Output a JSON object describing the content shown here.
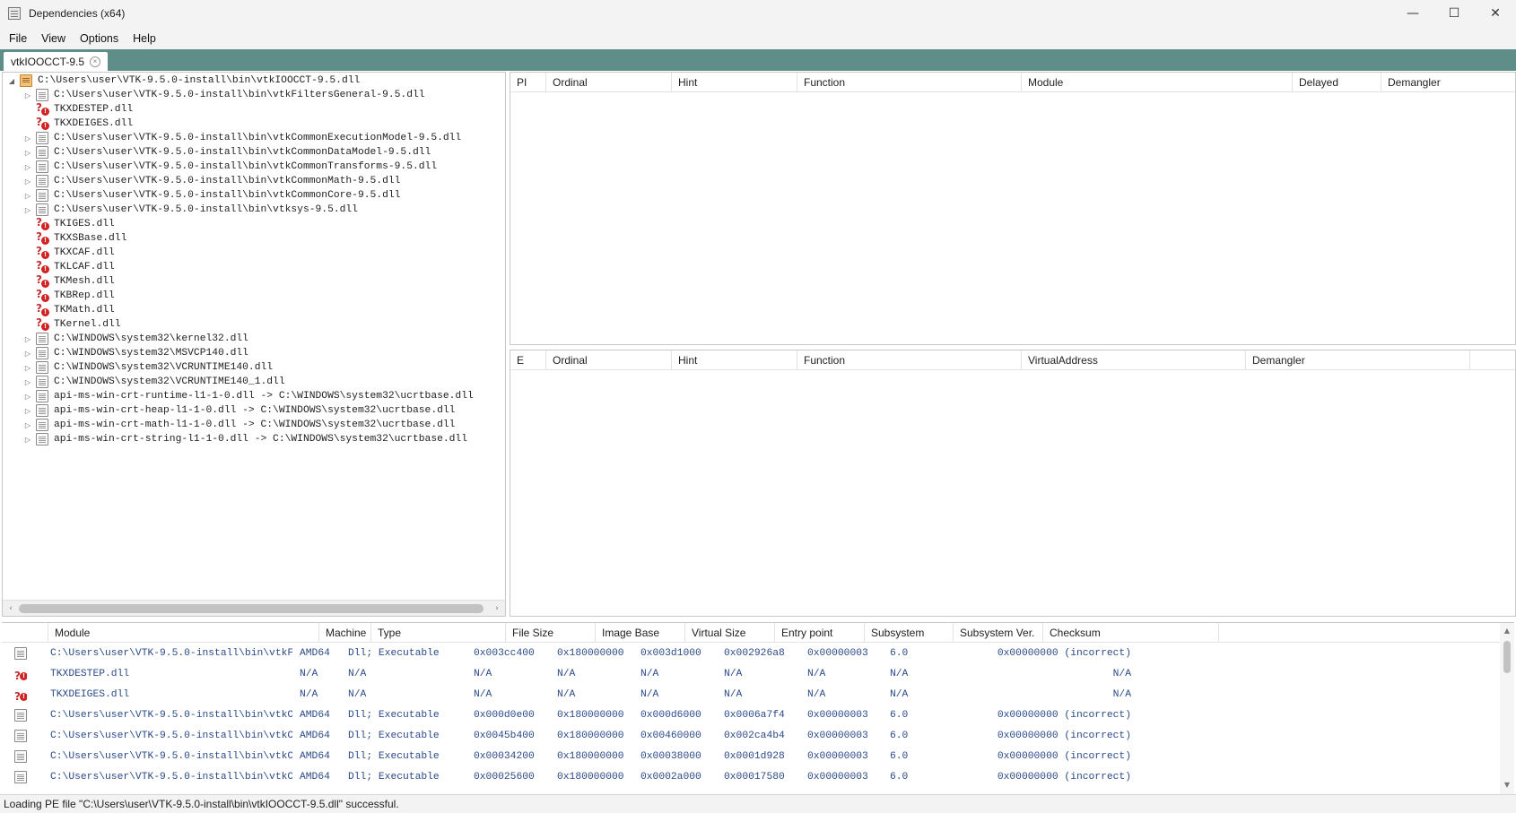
{
  "window": {
    "title": "Dependencies (x64)",
    "controls": [
      "—",
      "☐",
      "✕"
    ]
  },
  "menu": [
    "File",
    "View",
    "Options",
    "Help"
  ],
  "tab": {
    "label": "vtkIOOCCT-9.5",
    "close": "×"
  },
  "tree": [
    {
      "text": "C:\\Users\\user\\VTK-9.5.0-install\\bin\\vtkIOOCCT-9.5.dll",
      "icon": "root",
      "toggle": "◢",
      "indent": 0
    },
    {
      "text": "C:\\Users\\user\\VTK-9.5.0-install\\bin\\vtkFiltersGeneral-9.5.dll",
      "icon": "file",
      "toggle": "▷",
      "indent": 1
    },
    {
      "text": "TKXDESTEP.dll",
      "icon": "missing",
      "toggle": "",
      "indent": 1
    },
    {
      "text": "TKXDEIGES.dll",
      "icon": "missing",
      "toggle": "",
      "indent": 1
    },
    {
      "text": "C:\\Users\\user\\VTK-9.5.0-install\\bin\\vtkCommonExecutionModel-9.5.dll",
      "icon": "file",
      "toggle": "▷",
      "indent": 1
    },
    {
      "text": "C:\\Users\\user\\VTK-9.5.0-install\\bin\\vtkCommonDataModel-9.5.dll",
      "icon": "file",
      "toggle": "▷",
      "indent": 1
    },
    {
      "text": "C:\\Users\\user\\VTK-9.5.0-install\\bin\\vtkCommonTransforms-9.5.dll",
      "icon": "file",
      "toggle": "▷",
      "indent": 1
    },
    {
      "text": "C:\\Users\\user\\VTK-9.5.0-install\\bin\\vtkCommonMath-9.5.dll",
      "icon": "file",
      "toggle": "▷",
      "indent": 1
    },
    {
      "text": "C:\\Users\\user\\VTK-9.5.0-install\\bin\\vtkCommonCore-9.5.dll",
      "icon": "file",
      "toggle": "▷",
      "indent": 1
    },
    {
      "text": "C:\\Users\\user\\VTK-9.5.0-install\\bin\\vtksys-9.5.dll",
      "icon": "file",
      "toggle": "▷",
      "indent": 1
    },
    {
      "text": "TKIGES.dll",
      "icon": "missing",
      "toggle": "",
      "indent": 1
    },
    {
      "text": "TKXSBase.dll",
      "icon": "missing",
      "toggle": "",
      "indent": 1
    },
    {
      "text": "TKXCAF.dll",
      "icon": "missing",
      "toggle": "",
      "indent": 1
    },
    {
      "text": "TKLCAF.dll",
      "icon": "missing",
      "toggle": "",
      "indent": 1
    },
    {
      "text": "TKMesh.dll",
      "icon": "missing",
      "toggle": "",
      "indent": 1
    },
    {
      "text": "TKBRep.dll",
      "icon": "missing",
      "toggle": "",
      "indent": 1
    },
    {
      "text": "TKMath.dll",
      "icon": "missing",
      "toggle": "",
      "indent": 1
    },
    {
      "text": "TKernel.dll",
      "icon": "missing",
      "toggle": "",
      "indent": 1
    },
    {
      "text": "C:\\WINDOWS\\system32\\kernel32.dll",
      "icon": "file",
      "toggle": "▷",
      "indent": 1
    },
    {
      "text": "C:\\WINDOWS\\system32\\MSVCP140.dll",
      "icon": "file",
      "toggle": "▷",
      "indent": 1
    },
    {
      "text": "C:\\WINDOWS\\system32\\VCRUNTIME140.dll",
      "icon": "file",
      "toggle": "▷",
      "indent": 1
    },
    {
      "text": "C:\\WINDOWS\\system32\\VCRUNTIME140_1.dll",
      "icon": "file",
      "toggle": "▷",
      "indent": 1
    },
    {
      "text": "api-ms-win-crt-runtime-l1-1-0.dll -> C:\\WINDOWS\\system32\\ucrtbase.dll",
      "icon": "file",
      "toggle": "▷",
      "indent": 1
    },
    {
      "text": "api-ms-win-crt-heap-l1-1-0.dll -> C:\\WINDOWS\\system32\\ucrtbase.dll",
      "icon": "file",
      "toggle": "▷",
      "indent": 1
    },
    {
      "text": "api-ms-win-crt-math-l1-1-0.dll -> C:\\WINDOWS\\system32\\ucrtbase.dll",
      "icon": "file",
      "toggle": "▷",
      "indent": 1
    },
    {
      "text": "api-ms-win-crt-string-l1-1-0.dll -> C:\\WINDOWS\\system32\\ucrtbase.dll",
      "icon": "file",
      "toggle": "▷",
      "indent": 1
    }
  ],
  "imports_columns": [
    "PI",
    "Ordinal",
    "Hint",
    "Function",
    "Module",
    "Delayed",
    "Demangler"
  ],
  "exports_columns": [
    "E",
    "Ordinal",
    "Hint",
    "Function",
    "VirtualAddress",
    "Demangler"
  ],
  "modules_columns": [
    "Module",
    "Machine",
    "Type",
    "File Size",
    "Image Base",
    "Virtual Size",
    "Entry point",
    "Subsystem",
    "Subsystem Ver.",
    "Checksum"
  ],
  "modules": [
    {
      "icon": "file",
      "cells": [
        "C:\\Users\\user\\VTK-9.5.0-install\\bin\\vtkF",
        "AMD64",
        "Dll; Executable",
        "0x003cc400",
        "0x180000000",
        "0x003d1000",
        "0x002926a8",
        "0x00000003",
        "6.0",
        "0x00000000 (incorrect)"
      ]
    },
    {
      "icon": "missing",
      "cells": [
        "TKXDESTEP.dll",
        "N/A",
        "N/A",
        "N/A",
        "N/A",
        "N/A",
        "N/A",
        "N/A",
        "N/A",
        "N/A"
      ]
    },
    {
      "icon": "missing",
      "cells": [
        "TKXDEIGES.dll",
        "N/A",
        "N/A",
        "N/A",
        "N/A",
        "N/A",
        "N/A",
        "N/A",
        "N/A",
        "N/A"
      ]
    },
    {
      "icon": "file",
      "cells": [
        "C:\\Users\\user\\VTK-9.5.0-install\\bin\\vtkC",
        "AMD64",
        "Dll; Executable",
        "0x000d0e00",
        "0x180000000",
        "0x000d6000",
        "0x0006a7f4",
        "0x00000003",
        "6.0",
        "0x00000000 (incorrect)"
      ]
    },
    {
      "icon": "file",
      "cells": [
        "C:\\Users\\user\\VTK-9.5.0-install\\bin\\vtkC",
        "AMD64",
        "Dll; Executable",
        "0x0045b400",
        "0x180000000",
        "0x00460000",
        "0x002ca4b4",
        "0x00000003",
        "6.0",
        "0x00000000 (incorrect)"
      ]
    },
    {
      "icon": "file",
      "cells": [
        "C:\\Users\\user\\VTK-9.5.0-install\\bin\\vtkC",
        "AMD64",
        "Dll; Executable",
        "0x00034200",
        "0x180000000",
        "0x00038000",
        "0x0001d928",
        "0x00000003",
        "6.0",
        "0x00000000 (incorrect)"
      ]
    },
    {
      "icon": "file",
      "cells": [
        "C:\\Users\\user\\VTK-9.5.0-install\\bin\\vtkC",
        "AMD64",
        "Dll; Executable",
        "0x00025600",
        "0x180000000",
        "0x0002a000",
        "0x00017580",
        "0x00000003",
        "6.0",
        "0x00000000 (incorrect)"
      ]
    }
  ],
  "scroll_glyphs": {
    "left": "‹",
    "right": "›",
    "up": "▲",
    "down": "▼"
  },
  "status": "Loading PE file \"C:\\Users\\user\\VTK-9.5.0-install\\bin\\vtkIOOCCT-9.5.dll\" successful."
}
